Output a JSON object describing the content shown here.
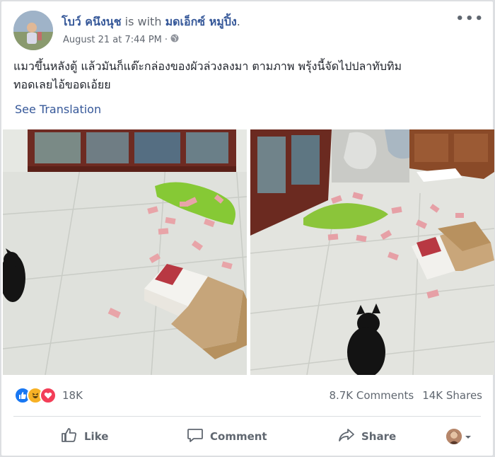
{
  "post": {
    "author": "โบว์ คนึงนุช",
    "with_word": "is with",
    "tagged": "มดเอ็กซ์ หมูปิ้ง",
    "period": ".",
    "timestamp": "August 21 at 7:44 PM",
    "separator": "·",
    "audience_icon": "globe-icon",
    "more_icon": "more-options-icon",
    "text_line1": "แมวขึ้นหลังตู้ แล้วมันก็แต๊ะกล่องของผัวล่วงลงมา ตามภาพ พรุ้งนี้จัดไปปลาทับทิม",
    "text_line2": "ทอดเลยไอ้ขอดเอ้ยย",
    "see_translation": "See Translation"
  },
  "stats": {
    "reactions": [
      "like-icon",
      "haha-icon",
      "love-icon"
    ],
    "reaction_count": "18K",
    "comments": "8.7K Comments",
    "shares": "14K Shares"
  },
  "actions": {
    "like": "Like",
    "comment": "Comment",
    "share": "Share"
  },
  "colors": {
    "link": "#365899",
    "secondary_text": "#606770",
    "like_blue": "#1877f2",
    "haha_yellow": "#f7b125",
    "love_red": "#f33e58"
  }
}
